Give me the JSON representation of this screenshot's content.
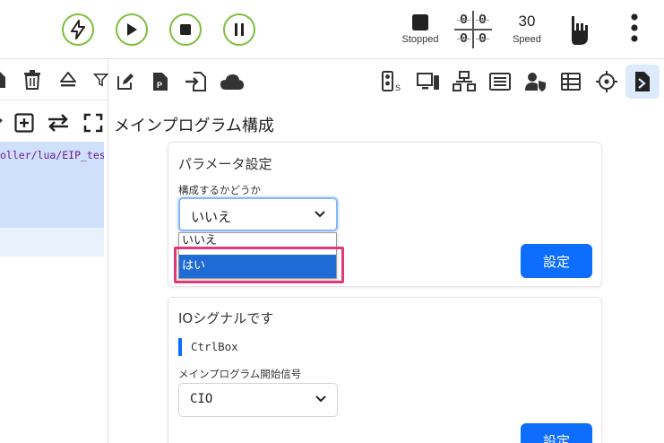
{
  "topbar": {
    "status_label": "Stopped",
    "speed_value": "30",
    "speed_label": "Speed",
    "counter_digits": [
      "0",
      "0",
      "0",
      "0"
    ],
    "accent_color": "#7cbf3b"
  },
  "left_panel": {
    "file_path": "oller/lua/EIP_tes",
    "path_color": "#6a1b9a",
    "toolbar_icons": [
      "file-icon",
      "trash-icon",
      "eject-icon",
      "filter-icon"
    ],
    "toolbar2_icons": [
      "edit-icon",
      "add-box-icon",
      "swap-icon",
      "fullscreen-icon"
    ]
  },
  "right_toolbar": {
    "icons": [
      "edit-icon",
      "file-p-icon",
      "import-icon",
      "cloud-icon",
      "io-status-icon",
      "devices-icon",
      "network-icon",
      "memory-icon",
      "user-shield-icon",
      "table-icon",
      "crosshair-icon",
      "document-active-icon"
    ],
    "active_index": 11
  },
  "main": {
    "page_title": "メインプログラム構成",
    "param_card": {
      "title": "パラメータ設定",
      "field_label": "構成するかどうか",
      "select_value": "いいえ",
      "options": [
        "いいえ",
        "はい"
      ],
      "highlighted_option": "はい",
      "button_label": "設定"
    },
    "io_card": {
      "title": "IOシグナルです",
      "signal_name": "CtrlBox",
      "field_label": "メインプログラム開始信号",
      "select_value": "CIO",
      "button_label": "設定"
    },
    "primary_color": "#0d6efd",
    "highlight_color": "#e0397a"
  }
}
